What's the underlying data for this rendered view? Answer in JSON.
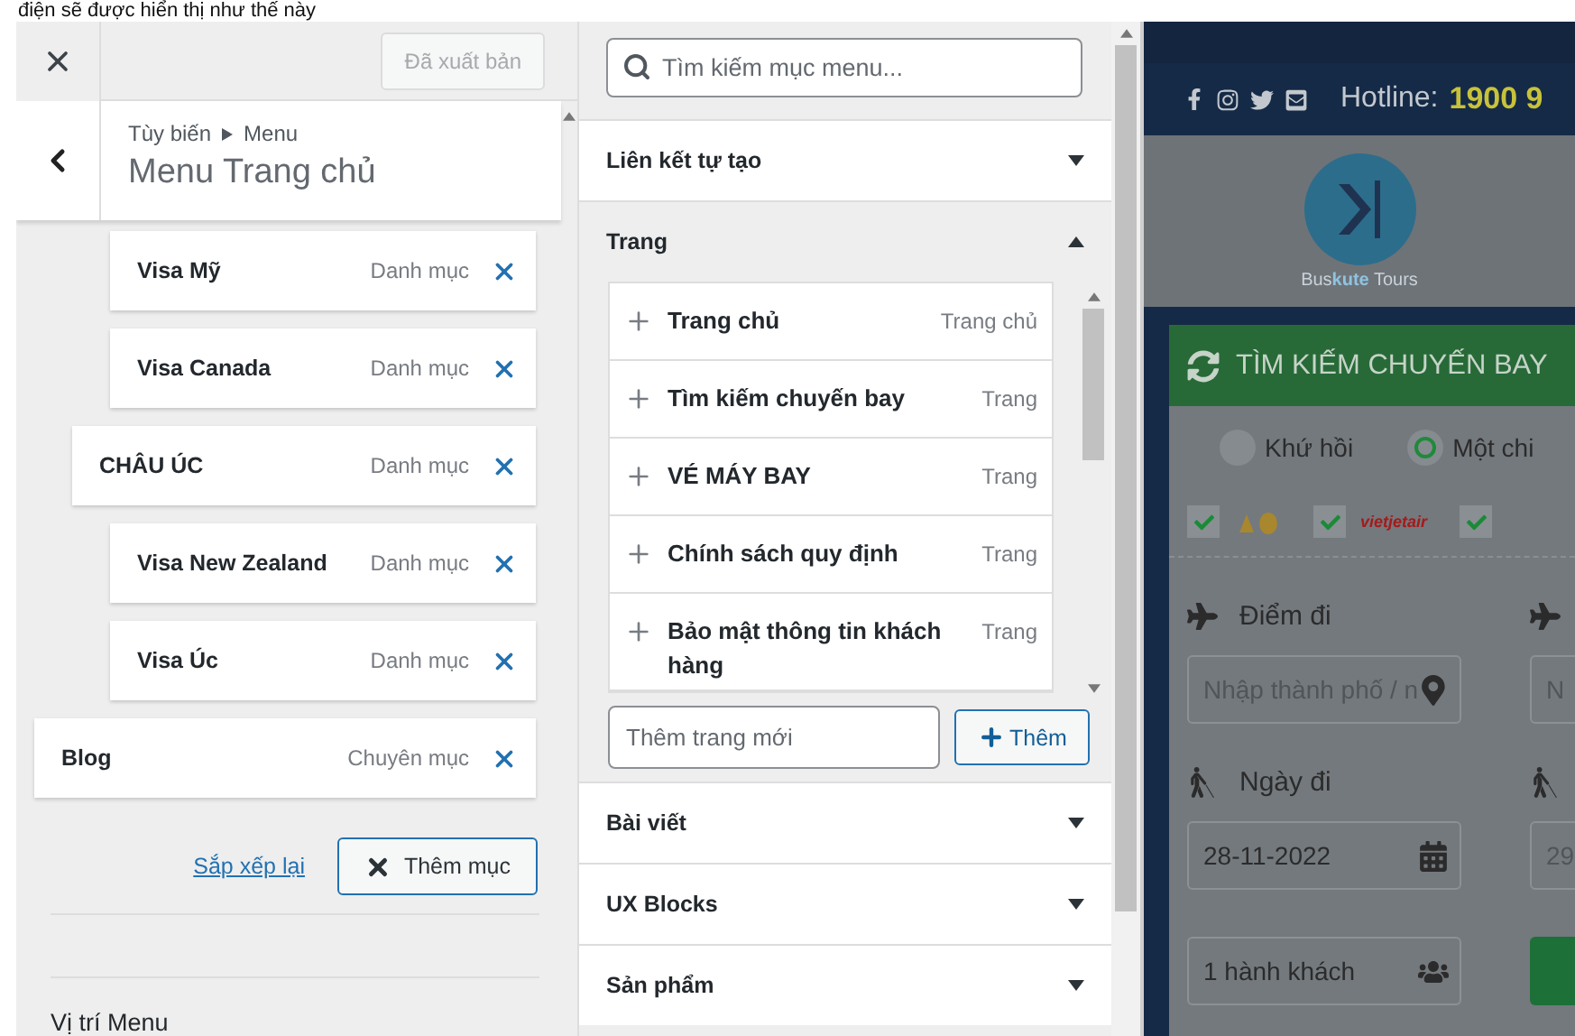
{
  "caption": "điện sẽ được hiển thị như thế này",
  "customizer": {
    "publish_button": {
      "label": "Đã xuất bản",
      "disabled": true
    },
    "breadcrumb": [
      "Tùy biến",
      "Menu"
    ],
    "title": "Menu Trang chủ",
    "menu_items": [
      {
        "children": [
          {
            "children": [
              {
                "title": "Visa Mỹ",
                "type": "Danh mục"
              },
              {
                "title": "Visa Canada",
                "type": "Danh mục"
              }
            ]
          },
          {
            "title": "CHÂU ÚC",
            "type": "Danh mục",
            "children": [
              {
                "title": "Visa New Zealand",
                "type": "Danh mục"
              },
              {
                "title": "Visa Úc",
                "type": "Danh mục"
              }
            ]
          }
        ]
      },
      {
        "title": "Blog",
        "type": "Chuyên mục"
      }
    ],
    "reorder_link": "Sắp xếp lại",
    "add_button": {
      "label": "Thêm mục",
      "expanded": true
    },
    "section_heading": "Vị trí Menu"
  },
  "item_picker": {
    "search": {
      "placeholder": "Tìm kiếm mục menu..."
    },
    "sections": [
      {
        "title": "Liên kết tự tạo",
        "expanded": false
      },
      {
        "title": "Trang",
        "expanded": true,
        "items": [
          {
            "title": "Trang chủ",
            "type": "Trang chủ"
          },
          {
            "title": "Tìm kiếm chuyến bay",
            "type": "Trang"
          },
          {
            "title": "VÉ MÁY BAY",
            "type": "Trang"
          },
          {
            "title": "Chính sách quy định",
            "type": "Trang"
          },
          {
            "title": "Bảo mật thông tin khách hàng",
            "type": "Trang"
          }
        ],
        "new_page": {
          "placeholder": "Thêm trang mới"
        },
        "add_button": "Thêm"
      },
      {
        "title": "Bài viết",
        "expanded": false
      },
      {
        "title": "UX Blocks",
        "expanded": false
      },
      {
        "title": "Sản phẩm",
        "expanded": false
      }
    ]
  },
  "preview": {
    "hotline_label": "Hotline:",
    "hotline_number": "1900 9",
    "brand": "Bus**kute** Tours",
    "search_title": "TÌM KIẾM CHUYẾN BAY",
    "trip_types": [
      {
        "label": "Khứ hồi",
        "selected": false
      },
      {
        "label": "Một chi",
        "selected": true
      }
    ],
    "airlines": [
      {
        "kind": "emblem",
        "checked": true
      },
      {
        "kind": "wordmark",
        "name": "vietjetair",
        "checked": true
      },
      {
        "kind": "cut",
        "checked": true
      }
    ],
    "origin": {
      "label": "Điểm đi",
      "placeholder": "Nhập thành phố / n"
    },
    "destination_placeholder": "N",
    "date": {
      "label": "Ngày đi",
      "value": "28-11-2022"
    },
    "return_date_value": "29",
    "passengers": "1  hành khách"
  }
}
